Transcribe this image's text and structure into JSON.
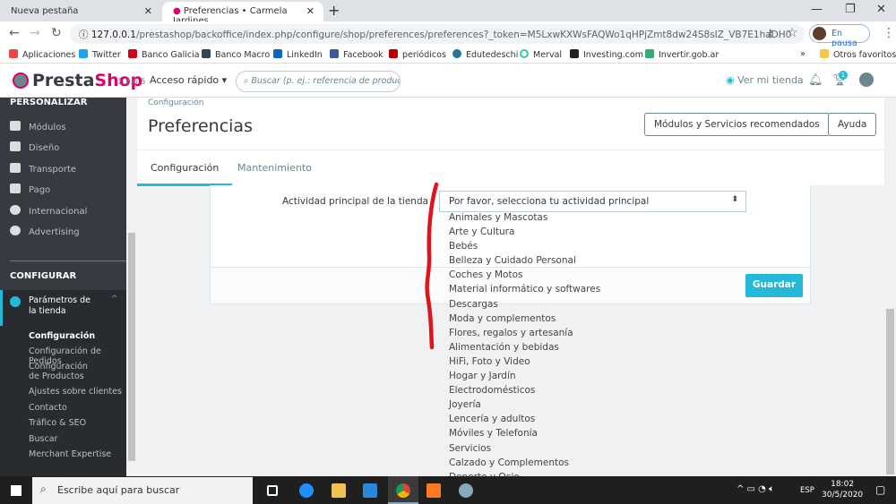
{
  "browser": {
    "tabs": [
      {
        "label": "Nueva pestaña"
      },
      {
        "label": "Preferencias • Carmela Jardines"
      }
    ],
    "url_host": "127.0.0.1",
    "url_path": "/prestashop/backoffice/index.php/configure/shop/preferences/preferences?_token=M5LxwKXWsFAQWo1qHPjZmt8dw24S8sIZ_VB7E1haDH0",
    "profile": "En pausa",
    "bookmarks": [
      "Aplicaciones",
      "Twitter",
      "Banco Galicia",
      "Banco Macro",
      "LinkedIn",
      "Facebook",
      "periódicos",
      "Edutedeschi",
      "Merval",
      "Investing.com",
      "Invertir.gob.ar"
    ],
    "other_bookmarks": "Otros favoritos"
  },
  "header": {
    "logo_a": "Presta",
    "logo_b": "Shop",
    "version": "1.7.6.5",
    "quick_access": "Acceso rápido",
    "search_placeholder": "Buscar (p. ej.: referencia de producto, no",
    "view_store": "Ver mi tienda",
    "notif_badge": "1"
  },
  "sidebar": {
    "section1": "PERSONALIZAR",
    "items": [
      "Módulos",
      "Diseño",
      "Transporte",
      "Pago",
      "Internacional",
      "Advertising"
    ],
    "section2": "CONFIGURAR",
    "active": "Parámetros de la tienda",
    "subitems": [
      "Configuración",
      "Configuración de Pedidos",
      "Configuración de Productos",
      "Ajustes sobre clientes",
      "Contacto",
      "Tráfico & SEO",
      "Buscar",
      "Merchant Expertise"
    ]
  },
  "page": {
    "breadcrumb": "Configuración",
    "title": "Preferencias",
    "btn_modules": "Módulos y Servicios recomendados",
    "btn_help": "Ayuda",
    "tabs": [
      "Configuración",
      "Mantenimiento"
    ],
    "field_label": "Actividad principal de la tienda",
    "select_value": "Por favor, selecciona tu actividad principal",
    "options": [
      "Animales y Mascotas",
      "Arte y Cultura",
      "Bebés",
      "Belleza y Cuidado Personal",
      "Coches y Motos",
      "Material informático y softwares",
      "Descargas",
      "Moda y complementos",
      "Flores, regalos y artesanía",
      "Alimentación y bebidas",
      "HiFi, Foto y Video",
      "Hogar y Jardín",
      "Electrodomésticos",
      "Joyería",
      "Lencería y adultos",
      "Móviles y Telefonía",
      "Servicios",
      "Calzado y Complementos",
      "Deporte y Ocio"
    ],
    "save": "Guardar"
  },
  "taskbar": {
    "search": "Escribe aquí para buscar",
    "lang": "ESP",
    "time": "18:02",
    "date": "30/5/2020"
  },
  "colors": {
    "accent": "#25b9d7",
    "sidebar": "#363a41",
    "annotation": "#e0141c"
  }
}
